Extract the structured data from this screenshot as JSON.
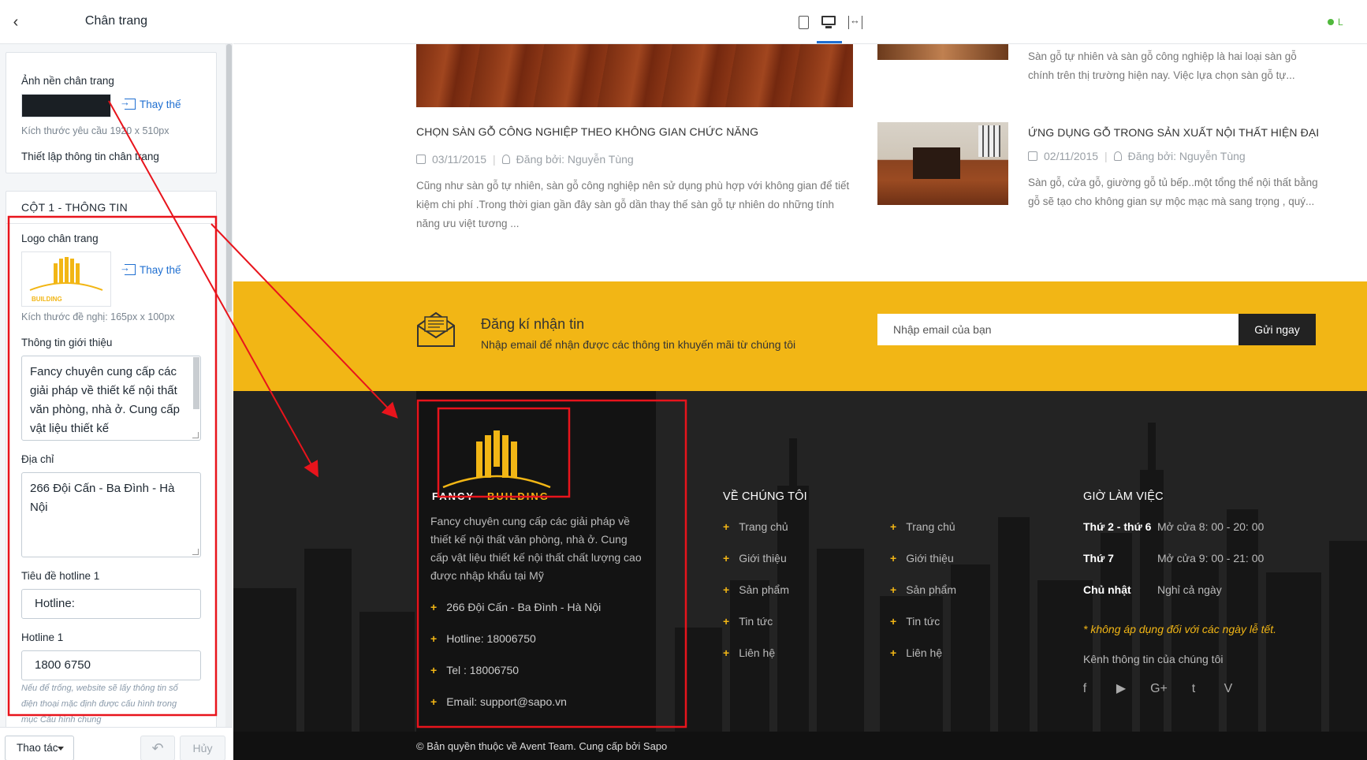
{
  "panel": {
    "title": "Chân trang",
    "bg_card": {
      "label": "Ảnh nền chân trang",
      "replace": "Thay thế",
      "size_hint": "Kích thước yêu cầu 1920 x 510px",
      "setup_label": "Thiết lập thông tin chân trang"
    },
    "col1": {
      "title": "CỘT 1 - THÔNG TIN",
      "logo_label": "Logo chân trang",
      "replace": "Thay thế",
      "logo_hint": "Kích thước đề nghị: 165px x 100px",
      "intro_label": "Thông tin giới thiệu",
      "intro_value": "Fancy chuyên cung cấp các giải pháp về thiết kế nội thất văn phòng, nhà ở. Cung cấp vật liệu thiết kế",
      "address_label": "Địa chỉ",
      "address_value": "266 Đội Cấn - Ba Đình - Hà Nội",
      "hotline1_title_label": "Tiêu đề hotline 1",
      "hotline1_title_value": "Hotline:",
      "hotline1_label": "Hotline 1",
      "hotline1_value": "1800 6750",
      "hotline_hint": "Nếu để trống, website sẽ lấy thông tin số điện thoại mặc định được cấu hình trong mục Cấu hình chung"
    },
    "footer": {
      "actions": "Thao tác",
      "cancel": "Hủy"
    }
  },
  "preview": {
    "status": "L",
    "posts": [
      {
        "title": "CHỌN SÀN GỖ CÔNG NGHIỆP THEO KHÔNG GIAN CHỨC NĂNG",
        "date": "03/11/2015",
        "author": "Đăng bởi: Nguyễn Tùng",
        "excerpt": "Cũng như sàn gỗ tự nhiên, sàn gỗ công nghiệp nên sử dụng phù hợp với không gian để tiết kiệm chi phí .Trong thời gian gần đây sàn gỗ dần thay thế sàn gỗ tự nhiên do những tính năng ưu việt tương ..."
      },
      {
        "title": "",
        "date": "",
        "author": "",
        "excerpt": "Sàn gỗ tự nhiên và sàn gỗ công nghiệp là hai loại sàn gỗ chính trên thị trường hiện nay. Việc lựa chọn sàn gỗ tự..."
      },
      {
        "title": "ỨNG DỤNG GỖ TRONG SẢN XUẤT NỘI THẤT HIỆN ĐẠI",
        "date": "02/11/2015",
        "author": "Đăng bởi: Nguyễn Tùng",
        "excerpt": "Sàn gỗ, cửa gỗ, giường gỗ tủ bếp..một tổng thể nội thất bằng gỗ sẽ tạo cho không gian sự mộc mạc mà sang trọng , quý..."
      }
    ],
    "newsletter": {
      "title": "Đăng kí nhận tin",
      "desc": "Nhập email để nhận được các thông tin khuyến mãi từ chúng tôi",
      "placeholder": "Nhập email của bạn",
      "submit": "Gửi ngay"
    },
    "footer": {
      "logo_text_1": "FANCY",
      "logo_text_2": "BUILDING",
      "about": "Fancy chuyên cung cấp các giải pháp về thiết kế nội thất văn phòng, nhà ở. Cung cấp vật liệu thiết kế nội thất chất lượng cao được nhập khẩu tại Mỹ",
      "contacts": [
        "266 Đội Cấn - Ba Đình - Hà Nội",
        "Hotline: 18006750",
        "Tel : 18006750",
        "Email: support@sapo.vn"
      ],
      "about_col_title": "VỀ CHÚNG TÔI",
      "links_a": [
        "Trang chủ",
        "Giới thiệu",
        "Sản phẩm",
        "Tin tức",
        "Liên hệ"
      ],
      "links_b": [
        "Trang chủ",
        "Giới thiệu",
        "Sản phẩm",
        "Tin tức",
        "Liên hệ"
      ],
      "hours_title": "GIỜ LÀM VIỆC",
      "hours": [
        {
          "day": "Thứ 2 - thứ 6",
          "time": "Mở cửa 8: 00 - 20: 00"
        },
        {
          "day": "Thứ 7",
          "time": "Mở cửa 9: 00 - 21: 00"
        },
        {
          "day": "Chủ nhật",
          "time": "Nghỉ cả ngày"
        }
      ],
      "hours_note": "* không áp dụng đối với các ngày lễ tết.",
      "channels_title": "Kênh thông tin của chúng tôi",
      "social": [
        "f",
        "▶",
        "G+",
        "t",
        "V"
      ],
      "copyright": "© Bản quyền thuộc về Avent Team. Cung cấp bởi Sapo"
    }
  },
  "colors": {
    "accent": "#f2b615",
    "annotation": "#e8141c",
    "link": "#1f6fd1"
  }
}
